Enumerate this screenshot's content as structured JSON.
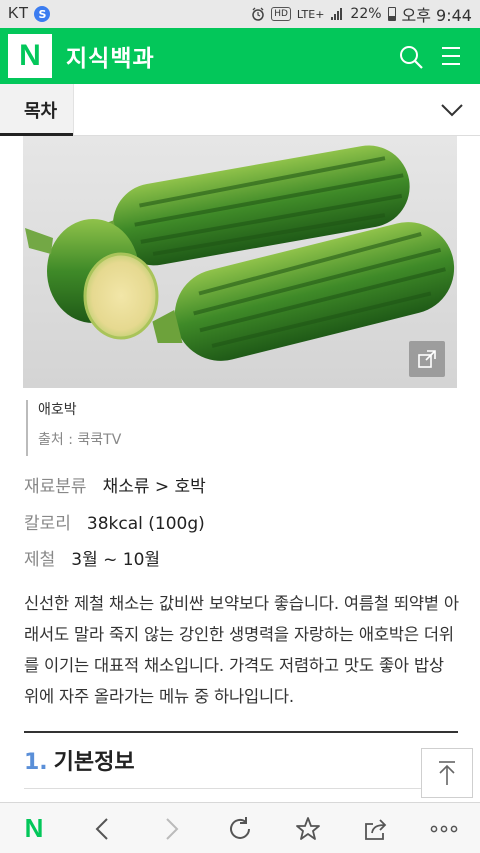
{
  "status_bar": {
    "carrier": "KT",
    "carrier_app_icon": "S",
    "hd_badge": "HD",
    "network": "LTE+",
    "battery": "22%",
    "time": "오후 9:44"
  },
  "app_bar": {
    "logo": "N",
    "title": "지식백과",
    "icons": [
      "search-icon",
      "menu-icon"
    ],
    "brand_color": "#03c75a"
  },
  "toc": {
    "label": "목차",
    "icon": "chevron-down-icon"
  },
  "figure": {
    "caption_title": "애호박",
    "caption_source": "출처 : 쿡쿡TV"
  },
  "info": [
    {
      "key": "재료분류",
      "value": "채소류 > 호박"
    },
    {
      "key": "칼로리",
      "value": "38kcal (100g)"
    },
    {
      "key": "제철",
      "value": "3월 ~ 10월"
    }
  ],
  "description": "신선한 제철 채소는 값비싼 보약보다 좋습니다. 여름철 뙤약볕 아래서도 말라 죽지 않는 강인한 생명력을 자랑하는 애호박은 더위를 이기는 대표적 채소입니다. 가격도 저렴하고 맛도 좋아 밥상 위에 자주 올라가는 메뉴 중 하나입니다.",
  "section": {
    "number": "1.",
    "title": "기본정보",
    "number_color": "#5a8fd8"
  },
  "bottom_nav": {
    "logo": "N",
    "icons": [
      "back-icon",
      "forward-icon",
      "refresh-icon",
      "bookmark-star-icon",
      "share-icon",
      "more-icon"
    ]
  }
}
